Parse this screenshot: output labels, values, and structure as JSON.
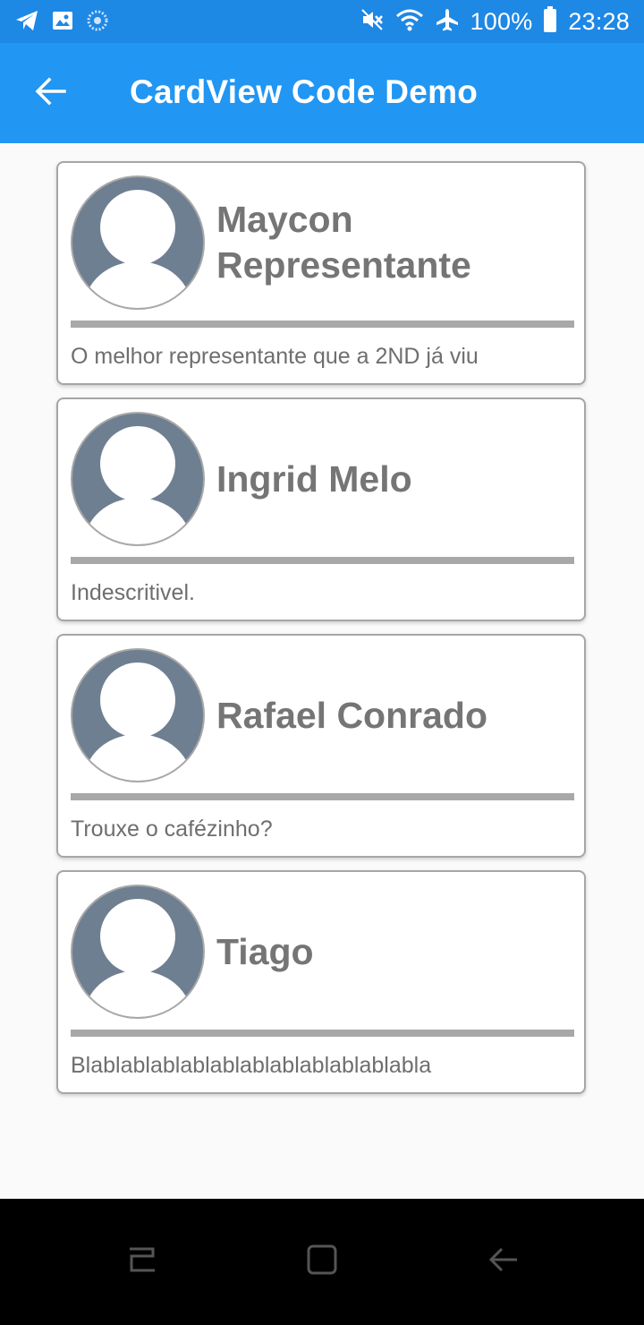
{
  "status_bar": {
    "battery_percent": "100%",
    "time": "23:28"
  },
  "app_bar": {
    "title": "CardView Code Demo"
  },
  "cards": [
    {
      "name": "Maycon Representante",
      "description": "O melhor representante que a 2ND já viu"
    },
    {
      "name": "Ingrid Melo",
      "description": "Indescritivel."
    },
    {
      "name": "Rafael Conrado",
      "description": "Trouxe o cafézinho?"
    },
    {
      "name": "Tiago",
      "description": "Blablablablablablablablablablablabla"
    }
  ],
  "colors": {
    "status_bar": "#1e88e5",
    "app_bar": "#2196f3",
    "avatar_bg": "#6f7f92",
    "name_text": "#757575"
  }
}
